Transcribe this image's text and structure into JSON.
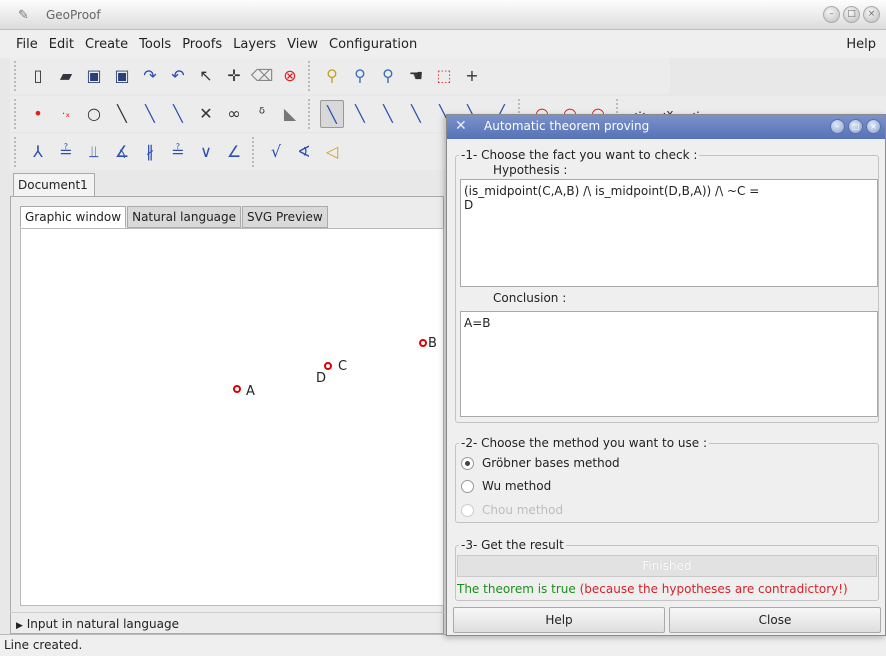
{
  "app": {
    "title": "GeoProof"
  },
  "menu": {
    "items": [
      "File",
      "Edit",
      "Create",
      "Tools",
      "Proofs",
      "Layers",
      "View",
      "Configuration"
    ],
    "help": "Help"
  },
  "toolbar1": {
    "icons": [
      "new-file-icon",
      "open-icon",
      "save-icon",
      "save-as-icon",
      "redo-icon",
      "undo-icon",
      "pointer-icon",
      "move-icon",
      "eraser-icon",
      "stop-icon",
      "zoom-in-icon",
      "zoom-out-icon",
      "zoom-fit-icon",
      "pan-hand-icon",
      "select-region-icon",
      "crosshair-icon"
    ]
  },
  "toolbar2": {
    "glyphs": [
      "•",
      "·",
      "○",
      "╲",
      "╲",
      "╲",
      "✕",
      "∞",
      "ᵟ",
      "◣",
      "╲",
      "╲",
      "╲",
      "╲",
      "╲",
      "╲",
      "╱",
      "○",
      "○",
      "○",
      "··",
      "·x",
      "··"
    ]
  },
  "toolbar3": {
    "glyphs": [
      "⅄",
      "≟",
      "⫫",
      "∡",
      "∦",
      "≟",
      "∨",
      "∠",
      "√",
      "∢",
      "◁"
    ]
  },
  "document": {
    "tab": "Document1"
  },
  "subtabs": [
    "Graphic window",
    "Natural language",
    "SVG Preview"
  ],
  "canvas": {
    "points": [
      {
        "label": "B"
      },
      {
        "label": "C"
      },
      {
        "label": "D"
      },
      {
        "label": "A"
      }
    ]
  },
  "natural_language": {
    "label": "Input in natural language"
  },
  "status": {
    "text": "Line created."
  },
  "dialog": {
    "title": "Automatic theorem proving",
    "step1": {
      "label": "-1- Choose the fact you want to check :",
      "hypothesis_label": "Hypothesis :",
      "hypothesis": "(is_midpoint(C,A,B) /\\ is_midpoint(D,B,A)) /\\ ~C =\nD",
      "conclusion_label": "Conclusion :",
      "conclusion": "A=B"
    },
    "step2": {
      "label": "-2- Choose the method you want to use :",
      "methods": [
        "Gröbner bases method",
        "Wu method",
        "Chou method"
      ],
      "selected": "Gröbner bases method"
    },
    "step3": {
      "label": "-3- Get the result",
      "button": "Finished",
      "result_ok": "The theorem is true",
      "result_reason": " (because the hypotheses are contradictory!)"
    },
    "help_button": "Help",
    "close_button": "Close"
  }
}
